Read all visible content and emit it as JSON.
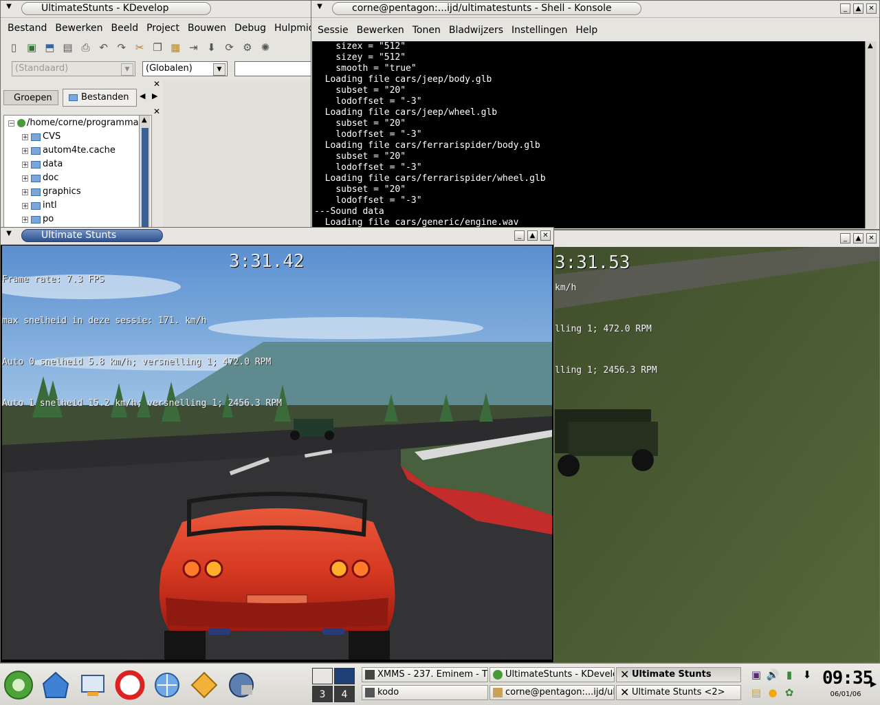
{
  "kdevelop": {
    "title": "UltimateStunts - KDevelop",
    "menu": [
      "Bestand",
      "Bewerken",
      "Beeld",
      "Project",
      "Bouwen",
      "Debug",
      "Hulpmiddelen"
    ],
    "combo1": "(Standaard)",
    "combo2": "(Globalen)",
    "tabs": {
      "groups": "Groepen",
      "files": "Bestanden"
    },
    "tree_root": "/home/corne/programma-s",
    "tree_items": [
      "CVS",
      "autom4te.cache",
      "data",
      "doc",
      "graphics",
      "intl",
      "po"
    ]
  },
  "konsole": {
    "title": "corne@pentagon:...ijd/ultimatestunts - Shell - Konsole",
    "menu": [
      "Sessie",
      "Bewerken",
      "Tonen",
      "Bladwijzers",
      "Instellingen",
      "Help"
    ],
    "lines": [
      "    sizex = \"512\"",
      "    sizey = \"512\"",
      "    smooth = \"true\"",
      "  Loading file cars/jeep/body.glb",
      "    subset = \"20\"",
      "    lodoffset = \"-3\"",
      "  Loading file cars/jeep/wheel.glb",
      "    subset = \"20\"",
      "    lodoffset = \"-3\"",
      "  Loading file cars/ferrarispider/body.glb",
      "    subset = \"20\"",
      "    lodoffset = \"-3\"",
      "  Loading file cars/ferrarispider/wheel.glb",
      "    subset = \"20\"",
      "    lodoffset = \"-3\"",
      "---Sound data",
      "  Loading file cars/generic/engine.wav"
    ]
  },
  "game1": {
    "title": "Ultimate Stunts",
    "hud": [
      "Frame rate: 7.3 FPS",
      "max snelheid in deze sessie: 171.",
      "Auto 0 snelheid 5.8 km/h; versnelling 1; 472.0 RPM",
      "Auto 1 snelheid 15.2 km/h; versnelling 1; 2456.3 RPM"
    ],
    "hud_kmh": "km/h",
    "timer": "3:31.42"
  },
  "game2": {
    "hud": [
      "km/h",
      "lling 1; 472.0 RPM",
      "lling 1; 2456.3 RPM"
    ],
    "timer": "3:31.53"
  },
  "taskbar": {
    "desktops": [
      "3",
      "4"
    ],
    "tasks": [
      "XMMS - 237. Eminem - T",
      "UltimateStunts - KDevelo",
      "Ultimate Stunts",
      "kodo",
      "corne@pentagon:...ijd/ult",
      "Ultimate Stunts <2>"
    ],
    "clock": "09:35",
    "date": "06/01/06"
  },
  "icons": {
    "menu": "chevron-down-icon",
    "close": "close-icon",
    "max": "maximize-icon",
    "min": "minimize-icon"
  },
  "colors": {
    "title_active": "#2f518d",
    "terminal_bg": "#000000",
    "sky": "#4f86c6",
    "grass": "#4a5a34"
  }
}
